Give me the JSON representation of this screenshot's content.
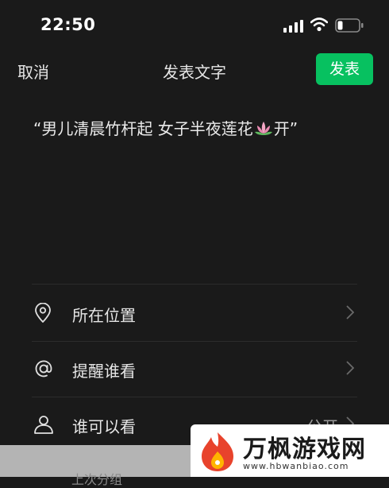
{
  "status_bar": {
    "time": "22:50",
    "icons": [
      "signal-icon",
      "wifi-icon",
      "battery-icon"
    ]
  },
  "nav": {
    "cancel_label": "取消",
    "title": "发表文字",
    "publish_label": "发表"
  },
  "post": {
    "text_before": "“男儿清晨竹杆起 女子半夜莲花",
    "emoji": "lotus-icon",
    "text_after": "开”"
  },
  "menu": {
    "items": [
      {
        "label": "所在位置",
        "icon": "location-pin-icon",
        "value": ""
      },
      {
        "label": "提醒谁看",
        "icon": "at-icon",
        "value": ""
      },
      {
        "label": "谁可以看",
        "icon": "person-icon",
        "value": "公开"
      }
    ]
  },
  "bottom_sheet": {
    "partial_text": "上次分组"
  },
  "watermark": {
    "name": "万枫游戏网",
    "url": "www.hbwanbiao.com"
  },
  "colors": {
    "background": "#1a1a1a",
    "accent": "#07c160",
    "text": "#e6e6e6",
    "secondary_text": "#9a9a9a"
  }
}
